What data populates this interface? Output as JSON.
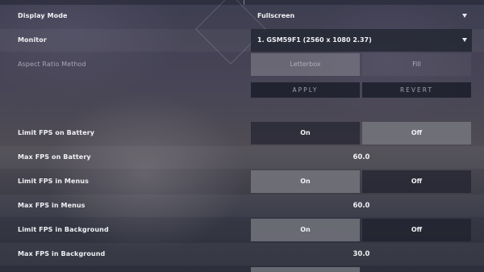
{
  "display_mode": {
    "label": "Display Mode",
    "value": "Fullscreen"
  },
  "monitor": {
    "label": "Monitor",
    "value": "1. GSM59F1 (2560 x 1080 2.37)"
  },
  "aspect_ratio": {
    "label": "Aspect Ratio Method",
    "option_letterbox": "Letterbox",
    "option_fill": "Fill",
    "selected": "Letterbox"
  },
  "actions": {
    "apply": "APPLY",
    "revert": "REVERT"
  },
  "limit_fps_battery": {
    "label": "Limit FPS on Battery",
    "on": "On",
    "off": "Off",
    "selected": "Off"
  },
  "max_fps_battery": {
    "label": "Max FPS on Battery",
    "value": "60.0"
  },
  "limit_fps_menus": {
    "label": "Limit FPS in Menus",
    "on": "On",
    "off": "Off",
    "selected": "On"
  },
  "max_fps_menus": {
    "label": "Max FPS in Menus",
    "value": "60.0"
  },
  "limit_fps_background": {
    "label": "Limit FPS in Background",
    "on": "On",
    "off": "Off",
    "selected": "On"
  },
  "max_fps_background": {
    "label": "Max FPS in Background",
    "value": "30.0"
  }
}
